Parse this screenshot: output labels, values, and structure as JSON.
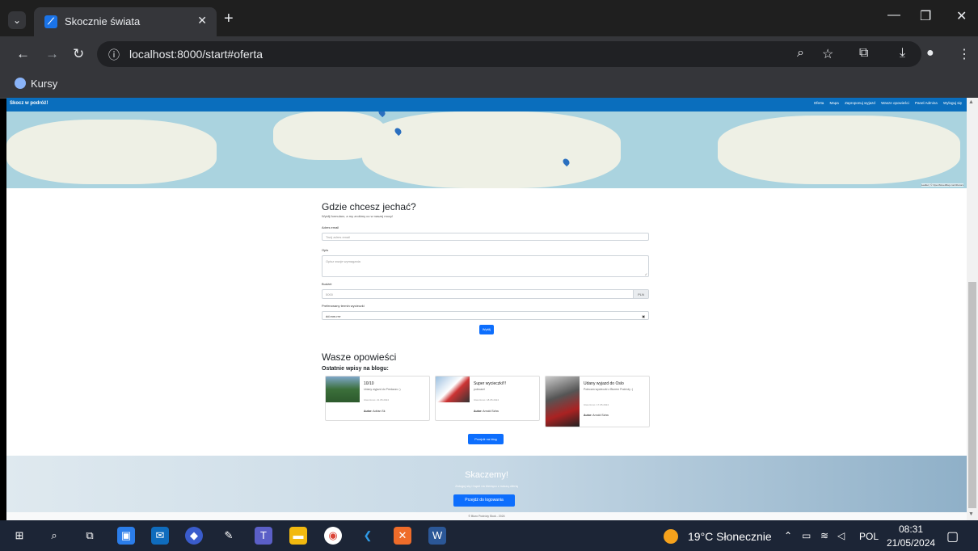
{
  "browser": {
    "tab_title": "Skocznie świata",
    "url": "localhost:8000/start#oferta",
    "bookmark": "Kursy"
  },
  "site": {
    "brand": "Skocz w podróż!",
    "nav": [
      "Oferta",
      "Mapa",
      "Zaproponuj wyjazd",
      "Wasze opowieści",
      "Panel Admina",
      "Wyloguj się"
    ]
  },
  "form": {
    "title": "Gdzie chcesz jechać?",
    "lead": "Wyślij formularz, a my zrobimy co w naszej mocy!",
    "email_label": "Adres email",
    "email_placeholder": "Twój adres email",
    "desc_label": "Opis",
    "desc_placeholder": "Opisz swoje wymagania",
    "budget_label": "Budżet",
    "budget_value": "5000",
    "budget_currency": "PLN",
    "date_label": "Preferowany termin wycieczki",
    "date_placeholder": "dd.mm.rrrr",
    "submit": "Wyślij"
  },
  "blog": {
    "title": "Wasze opowieści",
    "subtitle": "Ostatnie wpisy na blogu:",
    "cards": [
      {
        "title": "10/10",
        "desc": "Udany wyjazd do Predazzo :)",
        "date": "Utworzono: 21.05.2024",
        "author_label": "Autor:",
        "author": "Adrian Sk"
      },
      {
        "title": "Super wycieczki!!!",
        "desc": "polecam!",
        "date": "Utworzono: 18.05.2024",
        "author_label": "Autor:",
        "author": "Arnold Schw"
      },
      {
        "title": "Udany wyjazd do Oslo",
        "desc": "Polecam wycieczki z Biurem Podróży :)",
        "date": "Utworzono: 17.05.2024",
        "author_label": "Autor:",
        "author": "Arnold Schw"
      }
    ],
    "button": "Przejdź na blog"
  },
  "hero": {
    "title": "Skaczemy!",
    "subtitle": "Zaloguj się i bądź na bieżąco z naszą ofertą",
    "button": "Przejdź do logowania"
  },
  "footer": "© Biuro Podróży Skok - 2024",
  "taskbar": {
    "weather": "19°C Słonecznie",
    "lang": "POL",
    "time": "08:31",
    "date": "21/05/2024"
  },
  "colors": {
    "navbar": "#0a6ebd",
    "button": "#0d6efd"
  }
}
